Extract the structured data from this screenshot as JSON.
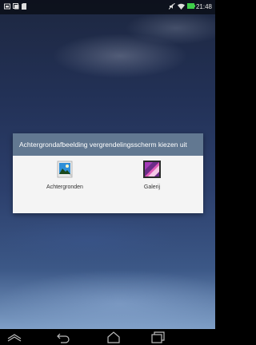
{
  "status_bar": {
    "time": "21:48",
    "left_icons": [
      "screenshot-icon",
      "gallery-notification-icon",
      "sd-card-icon"
    ],
    "right_icons": [
      "mute-icon",
      "wifi-icon",
      "battery-icon"
    ]
  },
  "dialog": {
    "title": "Achtergrondafbeelding vergrendelingsscherm kiezen uit",
    "options": [
      {
        "label": "Achtergronden",
        "icon": "wallpapers-icon"
      },
      {
        "label": "Galerij",
        "icon": "gallery-icon"
      }
    ]
  },
  "nav_bar": {
    "buttons": [
      "hide-icon",
      "back-icon",
      "home-icon",
      "recent-apps-icon"
    ]
  },
  "colors": {
    "dialog_header": "#627891",
    "dialog_body": "#f4f4f4",
    "battery": "#3fcf4a"
  }
}
